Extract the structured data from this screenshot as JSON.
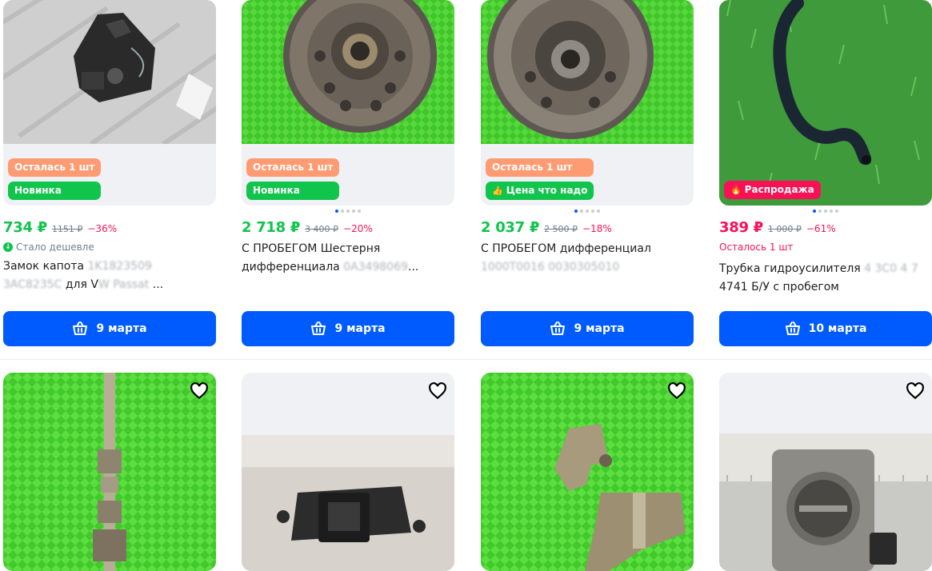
{
  "products": [
    {
      "badges": [
        {
          "text": "Осталась 1 шт",
          "kind": "orange"
        },
        {
          "text": "Новинка",
          "kind": "green"
        }
      ],
      "price": "734 ₽",
      "old_price": "1151 ₽",
      "discount": "−36%",
      "sub": "Стало дешевле",
      "title_visible": "Замок капота",
      "title_blur": " 1K1823509",
      "title_line2_blur": "3AC8235C",
      "title_line2_visible": " для V",
      "title_line2_blur2": "W Passat",
      "title_line2_rest": " ...",
      "delivery": "9 марта"
    },
    {
      "badges": [
        {
          "text": "Осталась 1 шт",
          "kind": "orange"
        },
        {
          "text": "Новинка",
          "kind": "green"
        }
      ],
      "price": "2 718 ₽",
      "old_price": "3 400 ₽",
      "discount": "−20%",
      "title_line1": "С ПРОБЕГОМ Шестерня",
      "title_line2": "дифференциала",
      "title_line2_blur": " 0A3498069",
      "title_line2_rest": "...",
      "delivery": "9 марта"
    },
    {
      "badges": [
        {
          "text": "Осталась 1 шт",
          "kind": "orange"
        },
        {
          "text": "Цена что надо",
          "kind": "green"
        }
      ],
      "price": "2 037 ₽",
      "old_price": "2 500 ₽",
      "discount": "−18%",
      "title_line1": "С ПРОБЕГОМ дифференциал",
      "title_line2_blur": "1000T0016 0030305010",
      "delivery": "9 марта"
    },
    {
      "badges": [
        {
          "text": "Распродажа",
          "kind": "pink"
        }
      ],
      "price": "389 ₽",
      "old_price": "1 000 ₽",
      "discount": "−61%",
      "sub": "Осталось 1 шт",
      "title_line1": "Трубка гидроусилителя",
      "title_line1_blur": " 4 3C0 4 7",
      "title_line2": "4741 Б/У с пробегом",
      "delivery": "10 марта"
    }
  ],
  "colors": {
    "accent": "#005bff",
    "green": "#10c44c",
    "pink": "#f91155",
    "orange": "#ff9b72"
  },
  "icons": {
    "cart": "cart-icon",
    "heart": "heart-icon",
    "like": "thumbs-up-icon",
    "fire": "fire-icon",
    "down": "arrow-down-icon"
  }
}
